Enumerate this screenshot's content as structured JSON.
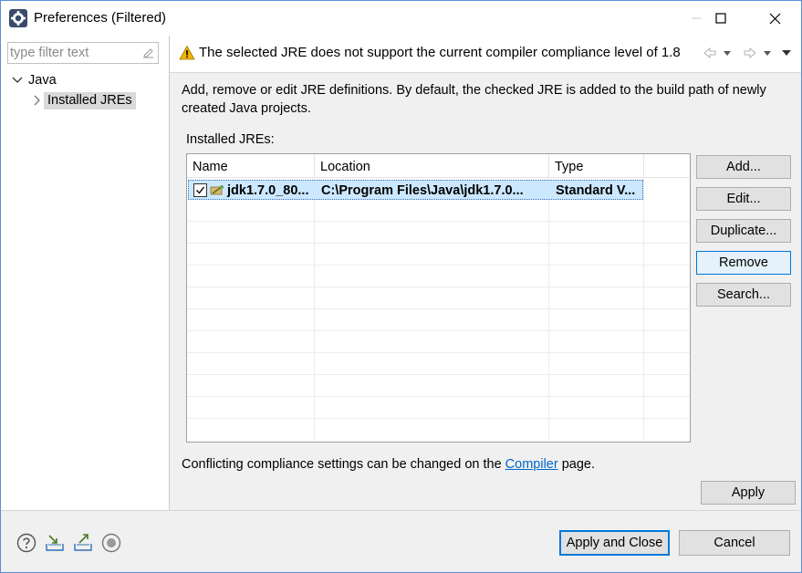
{
  "window": {
    "title": "Preferences (Filtered)"
  },
  "sidebar": {
    "filter_placeholder": "type filter text",
    "tree": [
      {
        "label": "Java",
        "expanded": true
      },
      {
        "label": "Installed JREs",
        "selected": true
      }
    ]
  },
  "banner": {
    "message": "The selected JRE does not support the current compiler compliance level of 1.8"
  },
  "page": {
    "description": "Add, remove or edit JRE definitions. By default, the checked JRE is added to the build path of newly created Java projects.",
    "installed_label": "Installed JREs:",
    "table": {
      "columns": [
        "Name",
        "Location",
        "Type"
      ],
      "rows": [
        {
          "checked": true,
          "name": "jdk1.7.0_80...",
          "location": "C:\\Program Files\\Java\\jdk1.7.0...",
          "type": "Standard V..."
        }
      ]
    },
    "side_buttons": {
      "add": "Add...",
      "edit": "Edit...",
      "duplicate": "Duplicate...",
      "remove": "Remove",
      "search": "Search..."
    },
    "conflict_prefix": "Conflicting compliance settings can be changed on the ",
    "conflict_link": "Compiler",
    "conflict_suffix": " page.",
    "apply_label": "Apply"
  },
  "footer": {
    "apply_close_label": "Apply and Close",
    "cancel_label": "Cancel",
    "icons": [
      "help-icon",
      "import-icon",
      "export-icon",
      "record-icon"
    ]
  },
  "colors": {
    "accent": "#0078d7",
    "selection": "#cce8ff",
    "link": "#0066cc",
    "warning": "#f2b400"
  }
}
